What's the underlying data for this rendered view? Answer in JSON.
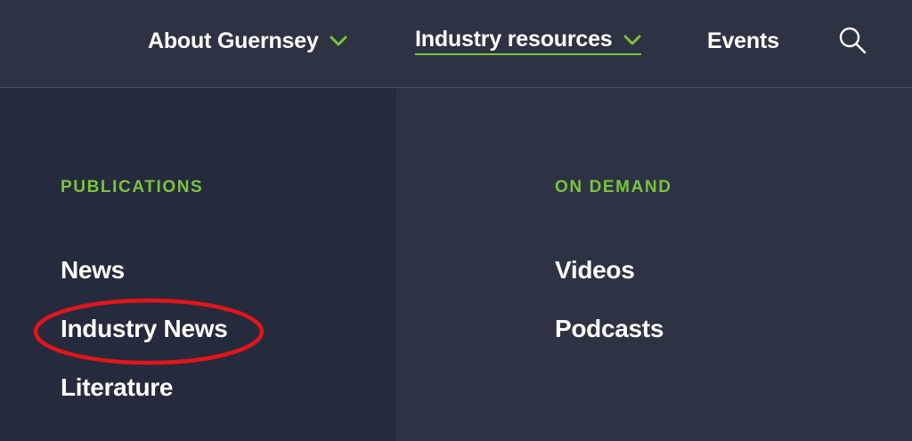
{
  "nav": {
    "about_label": "About Guernsey",
    "industry_label": "Industry resources",
    "events_label": "Events",
    "search_icon": "search-icon",
    "chevron_icon": "chevron-down-icon",
    "accent_color": "#7cc23f"
  },
  "dropdown": {
    "publications": {
      "heading": "PUBLICATIONS",
      "items": [
        "News",
        "Industry News",
        "Literature"
      ]
    },
    "on_demand": {
      "heading": "ON DEMAND",
      "items": [
        "Videos",
        "Podcasts"
      ]
    }
  },
  "annotation": {
    "type": "red-ellipse-highlight",
    "color": "#e3141b",
    "target": "Industry News"
  }
}
